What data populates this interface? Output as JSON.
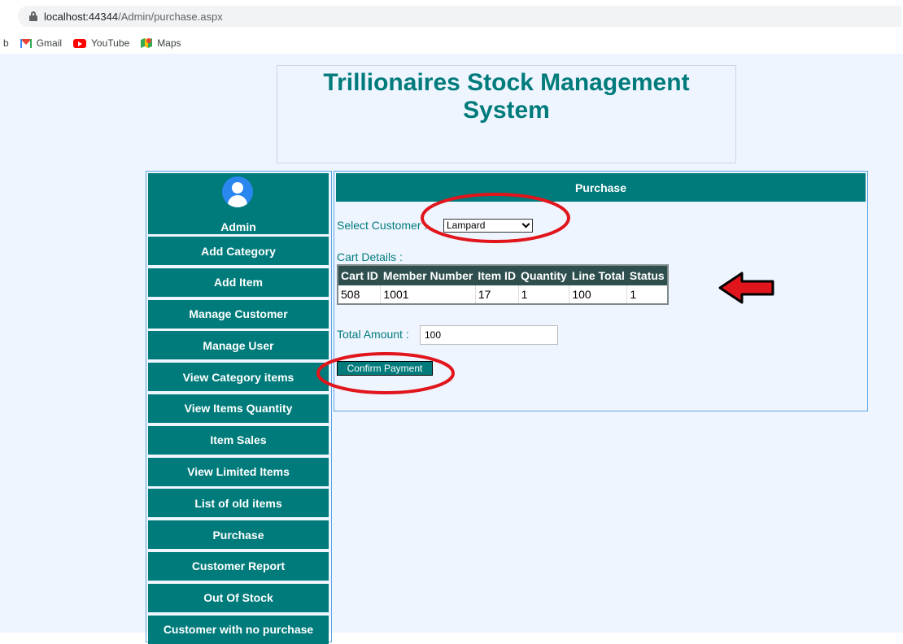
{
  "browser": {
    "url_host": "localhost:44344",
    "url_path": "/Admin/purchase.aspx",
    "bookmark_stub": "b",
    "bookmarks": [
      "Gmail",
      "YouTube",
      "Maps"
    ]
  },
  "header": {
    "title": "Trillionaires Stock Management System"
  },
  "sidebar": {
    "admin_label": "Admin",
    "items": [
      "Add Category",
      "Add Item",
      "Manage Customer",
      "Manage User",
      "View Category items",
      "View Items Quantity",
      "Item Sales",
      "View Limited Items",
      "List of old items",
      "Purchase",
      "Customer Report",
      "Out Of Stock",
      "Customer with no purchase"
    ]
  },
  "purchase": {
    "heading": "Purchase",
    "select_customer_label": "Select Customer :",
    "selected_customer": "Lampard",
    "cart_details_label": "Cart Details :",
    "table": {
      "headers": [
        "Cart ID",
        "Member Number",
        "Item ID",
        "Quantity",
        "Line Total",
        "Status"
      ],
      "rows": [
        [
          "508",
          "1001",
          "17",
          "1",
          "100",
          "1"
        ]
      ]
    },
    "total_amount_label": "Total Amount :",
    "total_amount_value": "100",
    "confirm_button": "Confirm Payment"
  },
  "colors": {
    "accent": "#007b7b",
    "table_header": "#2f4f4f",
    "page_bg": "#eff5ff",
    "annotation": "#e0161c"
  }
}
